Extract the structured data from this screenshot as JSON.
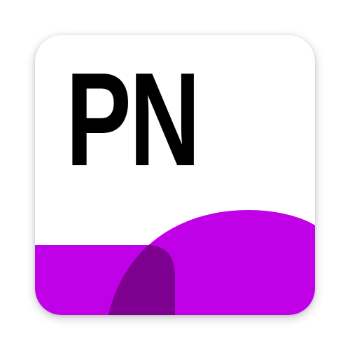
{
  "app_icon": {
    "abbreviation": "PN",
    "colors": {
      "background": "#ffffff",
      "text": "#000000",
      "accent": "#c000e6",
      "overlap": "#7e0090"
    }
  }
}
